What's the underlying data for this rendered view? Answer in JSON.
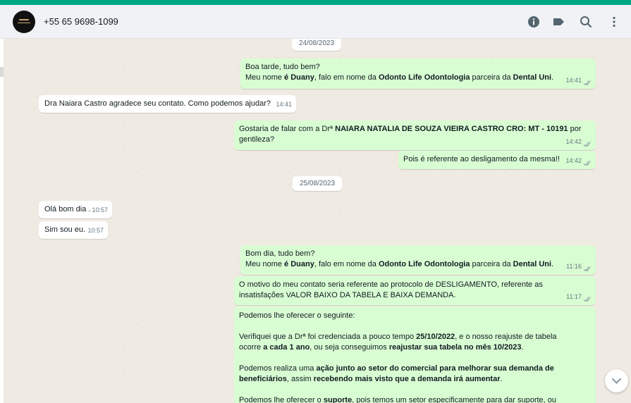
{
  "header": {
    "contact": "+55 65 9698-1099",
    "icons": [
      "info-icon",
      "label-icon",
      "search-icon",
      "menu-icon"
    ]
  },
  "colors": {
    "accent": "#00a884",
    "incoming": "#ffffff",
    "outgoing": "#d9fdd3",
    "chat_bg": "#efeae2"
  },
  "dates": {
    "d1": "24/08/2023",
    "d2": "25/08/2023"
  },
  "messages": {
    "m1": {
      "l1": "Boa tarde, tudo bem?",
      "l2a": "Meu nome ",
      "l2b": "é",
      "l2c": " ",
      "l2d": "Duany",
      "l2e": ", falo em nome da ",
      "l2f": "Odonto Life Odontologia",
      "l2g": " parceira da ",
      "l2h": "Dental Uni",
      "l2i": ".",
      "time": "14:41"
    },
    "m2": {
      "text": "Dra Naiara Castro agradece seu contato. Como podemos ajudar?",
      "time": "14:41"
    },
    "m3": {
      "a": "Gostaria de falar com a Drª ",
      "b": "NAIARA NATALIA DE SOUZA VIEIRA CASTRO CRO: MT - 10191",
      "c": " por",
      "d": "gentileza?",
      "time": "14:42"
    },
    "m4": {
      "text": "Pois é referente ao desligamento da mesma!!",
      "time": "14:42"
    },
    "m5": {
      "text": "Olá bom dia .",
      "time": "10:57"
    },
    "m6": {
      "text": "Sim sou eu.",
      "time": "10:57"
    },
    "m7": {
      "l1": "Bom dia, tudo bem?",
      "l2a": "Meu nome ",
      "l2b": "é",
      "l2c": " ",
      "l2d": "Duany",
      "l2e": ", falo em nome da ",
      "l2f": "Odonto Life Odontologia",
      "l2g": " parceira da ",
      "l2h": "Dental Uni",
      "l2i": ".",
      "time": "11:16"
    },
    "m8": {
      "l1": "O motivo do meu contato seria referente ao protocolo de DESLIGAMENTO, referente as",
      "l2": "insatisfações VALOR BAIXO DA TABELA E BAIXA DEMANDA.",
      "time": "11:17"
    },
    "m9": {
      "p1": "Podemos lhe oferecer o seguinte:",
      "p2a": "Verifiquei que a Drª foi credenciada a pouco tempo ",
      "p2b": "25/10/2022",
      "p2c": ", e o nosso reajuste de tabela",
      "p2d": "ocorre ",
      "p2e": "a cada 1 ano",
      "p2f": ", ou seja conseguimos ",
      "p2g": "reajustar sua tabela no mês 10/2023",
      "p2h": ".",
      "p3a": "Podemos realiza uma ",
      "p3b": "ação junto ao setor do comercial para melhorar sua demanda de",
      "p3c": "beneficiários",
      "p3d": ", assim ",
      "p3e": "recebendo mais visto que a demanda irá aumentar",
      "p3f": ".",
      "p4a": "Podemos lhe oferecer o ",
      "p4b": "suporte",
      "p4c": ", pois temos um setor especificamente para dar suporte, ou"
    }
  }
}
